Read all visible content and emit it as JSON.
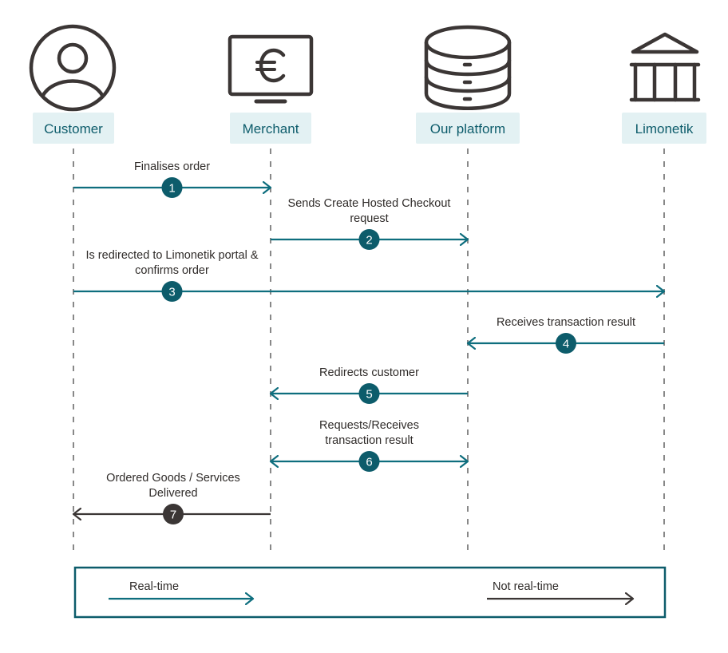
{
  "diagram": {
    "type": "sequence",
    "colors": {
      "realtime": "#0e6e7e",
      "not_realtime": "#3b3635",
      "badge_realtime": "#0d5c6b",
      "badge_not_realtime": "#3b3635",
      "label_bg": "#e3f1f3",
      "label_text": "#0d5c6b",
      "icon": "#3b3635",
      "lifeline": "#888888",
      "legend_border": "#0d5c6b"
    },
    "actors": [
      {
        "id": "customer",
        "label": "Customer",
        "icon": "user-circle-icon"
      },
      {
        "id": "merchant",
        "label": "Merchant",
        "icon": "monitor-euro-icon"
      },
      {
        "id": "platform",
        "label": "Our platform",
        "icon": "database-icon"
      },
      {
        "id": "limonetik",
        "label": "Limonetik",
        "icon": "bank-icon"
      }
    ],
    "messages": [
      {
        "step": "1",
        "from": "customer",
        "to": "merchant",
        "lines": [
          "Finalises order"
        ],
        "direction": "forward",
        "mode": "realtime"
      },
      {
        "step": "2",
        "from": "merchant",
        "to": "platform",
        "lines": [
          "Sends Create Hosted Checkout",
          "request"
        ],
        "direction": "forward",
        "mode": "realtime"
      },
      {
        "step": "3",
        "from": "customer",
        "to": "limonetik",
        "lines": [
          "Is redirected to Limonetik portal &",
          "confirms order"
        ],
        "direction": "forward",
        "mode": "realtime"
      },
      {
        "step": "4",
        "from": "limonetik",
        "to": "platform",
        "lines": [
          "Receives transaction result"
        ],
        "direction": "forward",
        "mode": "realtime"
      },
      {
        "step": "5",
        "from": "platform",
        "to": "merchant",
        "lines": [
          "Redirects customer"
        ],
        "direction": "forward",
        "mode": "realtime"
      },
      {
        "step": "6",
        "from": "merchant",
        "to": "platform",
        "lines": [
          "Requests/Receives",
          "transaction result"
        ],
        "direction": "both",
        "mode": "realtime"
      },
      {
        "step": "7",
        "from": "merchant",
        "to": "customer",
        "lines": [
          "Ordered Goods / Services",
          "Delivered"
        ],
        "direction": "forward",
        "mode": "not_realtime"
      }
    ],
    "legend": {
      "realtime_label": "Real-time",
      "not_realtime_label": "Not real-time"
    }
  }
}
